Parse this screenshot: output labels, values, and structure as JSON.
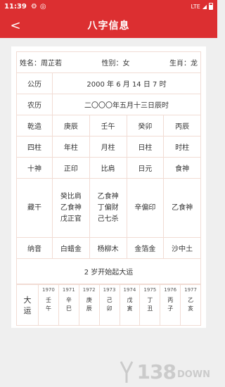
{
  "status": {
    "time": "11:39",
    "network": "LTE"
  },
  "header": {
    "title": "八字信息"
  },
  "info": {
    "name": "姓名：周芷若",
    "gender": "性别：女",
    "zodiac": "生肖：龙"
  },
  "gongli": {
    "label": "公历",
    "value": "2000 年 6 月 14 日 7 时"
  },
  "nongli": {
    "label": "农历",
    "value": "二〇〇〇年五月十三日辰时"
  },
  "qianzao": {
    "label": "乾造",
    "cols": [
      "庚辰",
      "壬午",
      "癸卯",
      "丙辰"
    ]
  },
  "sizhu": {
    "label": "四柱",
    "cols": [
      "年柱",
      "月柱",
      "日柱",
      "时柱"
    ]
  },
  "shishen": {
    "label": "十神",
    "cols": [
      "正印",
      "比肩",
      "日元",
      "食神"
    ]
  },
  "canggan": {
    "label": "藏干",
    "cols": [
      [
        "癸比肩",
        "乙食神",
        "戊正官"
      ],
      [
        "乙食神",
        "丁偏财",
        "己七杀"
      ],
      [
        "辛偏印"
      ],
      [
        "乙食神"
      ]
    ]
  },
  "nayin": {
    "label": "纳音",
    "cols": [
      "白蜡金",
      "杨柳木",
      "金箔金",
      "沙中土"
    ]
  },
  "start": {
    "text": "2 岁开始起大运"
  },
  "dayun": {
    "label1": "大",
    "label2": "运",
    "years": [
      "1970",
      "1971",
      "1972",
      "1973",
      "1974",
      "1975",
      "1976",
      "1977"
    ],
    "gz": [
      [
        "壬",
        "午"
      ],
      [
        "辛",
        "巳"
      ],
      [
        "庚",
        "辰"
      ],
      [
        "己",
        "卯"
      ],
      [
        "戊",
        "寅"
      ],
      [
        "丁",
        "丑"
      ],
      [
        "丙",
        "子"
      ],
      [
        "乙",
        "亥"
      ]
    ]
  },
  "watermark": {
    "num": "138",
    "down": "DOWN"
  },
  "colors": {
    "primary": "#dc2f31",
    "border": "#f1dcd4",
    "background": "#efefef"
  }
}
